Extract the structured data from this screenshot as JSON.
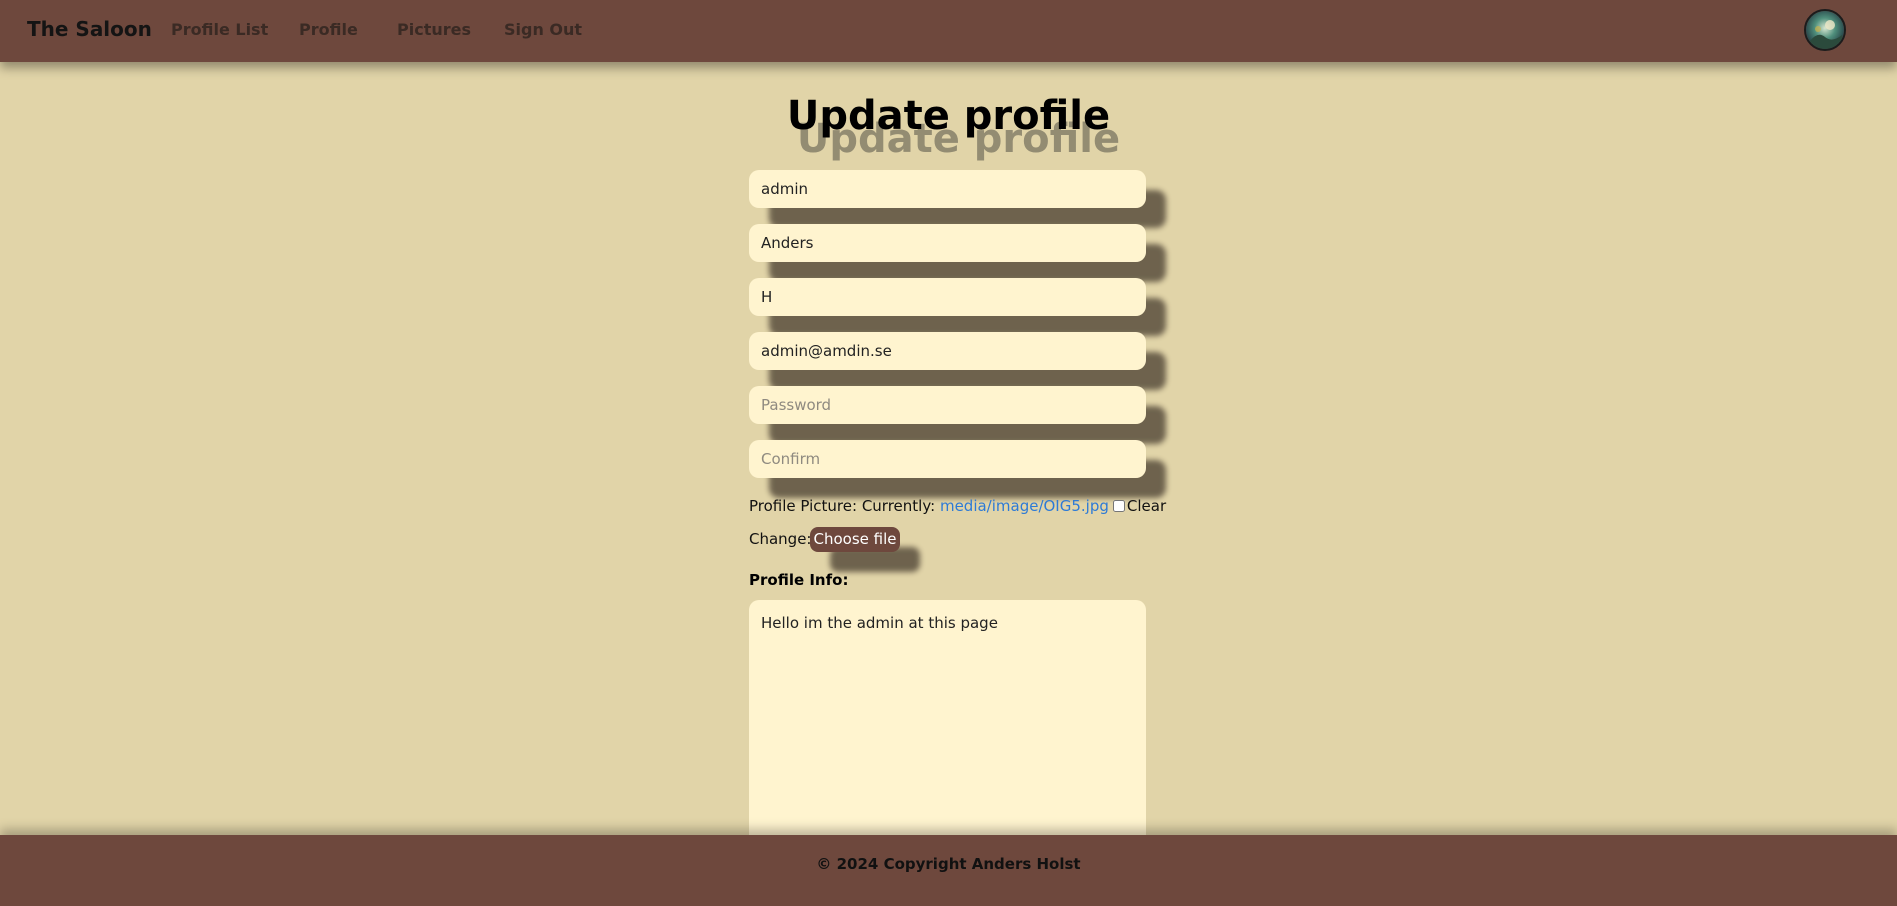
{
  "navbar": {
    "brand": "The Saloon",
    "links": [
      "Profile List",
      "Profile",
      "Pictures",
      "Sign Out"
    ],
    "background_color": "#6e483d"
  },
  "page": {
    "title": "Update profile",
    "background_color": "#e1d4a8"
  },
  "form": {
    "fields": [
      {
        "name": "username",
        "value": "admin",
        "placeholder": ""
      },
      {
        "name": "first_name",
        "value": "Anders",
        "placeholder": ""
      },
      {
        "name": "last_name",
        "value": "H",
        "placeholder": ""
      },
      {
        "name": "email",
        "value": "admin@amdin.se",
        "placeholder": ""
      },
      {
        "name": "password",
        "value": "",
        "placeholder": "Password"
      },
      {
        "name": "confirm",
        "value": "",
        "placeholder": "Confirm"
      }
    ],
    "profile_picture": {
      "label": "Profile Picture: Currently:",
      "current_link": "media/image/OIG5.jpg",
      "clear_label": "Clear",
      "clear_checked": false,
      "change_label": "Change:",
      "choose_file_label": "Choose file"
    },
    "profile_info": {
      "label": "Profile Info:",
      "value": "Hello im the admin at this page"
    },
    "field_color": "#fff4cf"
  },
  "footer": {
    "text": "© 2024 Copyright Anders Holst"
  }
}
